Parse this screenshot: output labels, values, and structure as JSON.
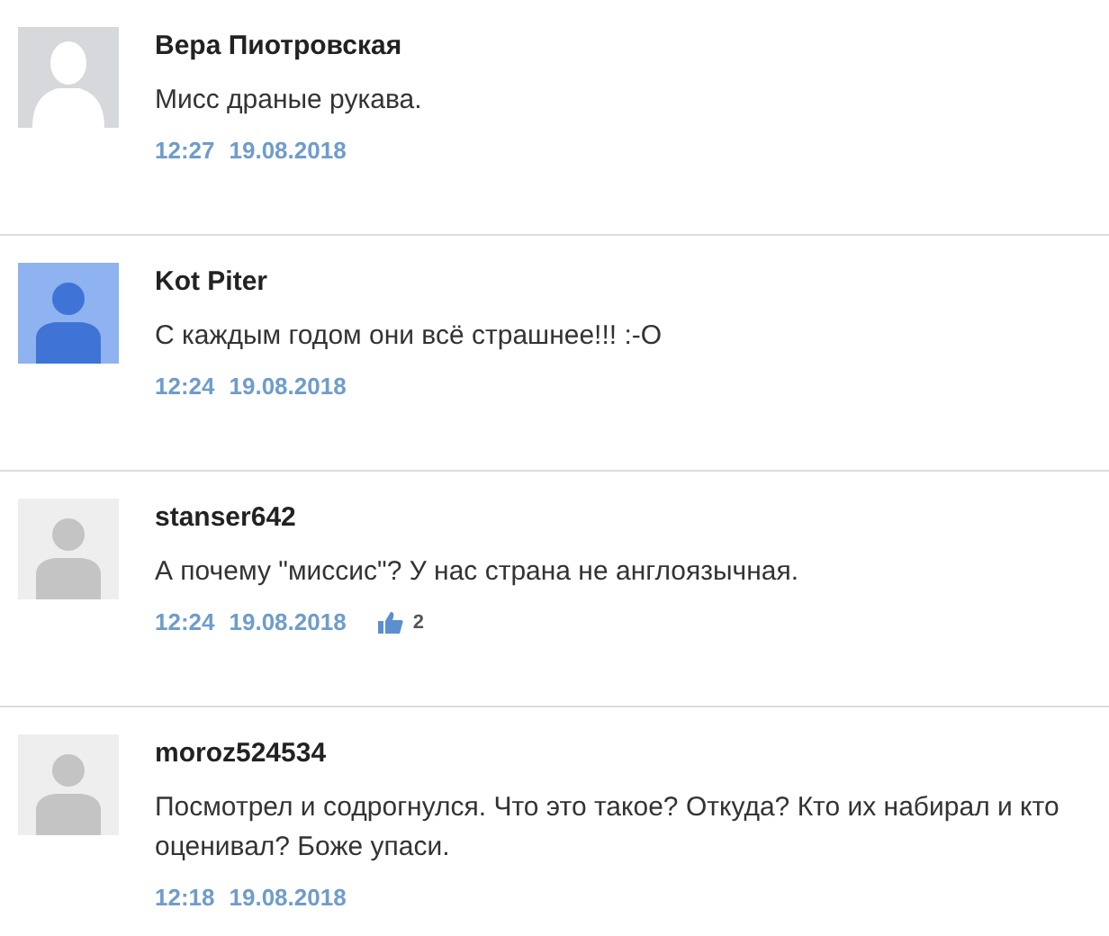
{
  "comments": [
    {
      "avatar": {
        "kind": "silhouette"
      },
      "author": "Вера Пиотровская",
      "text": "Мисс драные рукава.",
      "time": "12:27",
      "date": "19.08.2018"
    },
    {
      "avatar": {
        "kind": "blue"
      },
      "author": "Kot Piter",
      "text": "С каждым годом они всё страшнее!!! :-O",
      "time": "12:24",
      "date": "19.08.2018"
    },
    {
      "avatar": {
        "kind": "grey"
      },
      "author": "stanser642",
      "text": "А почему \"миссис\"? У нас страна не англоязычная.",
      "time": "12:24",
      "date": "19.08.2018",
      "likes": "2"
    },
    {
      "avatar": {
        "kind": "grey"
      },
      "author": "moroz524534",
      "text": "Посмотрел и содрогнулся. Что это такое? Откуда? Кто их набирал и кто оценивал? Боже упаси.",
      "time": "12:18",
      "date": "19.08.2018"
    }
  ]
}
